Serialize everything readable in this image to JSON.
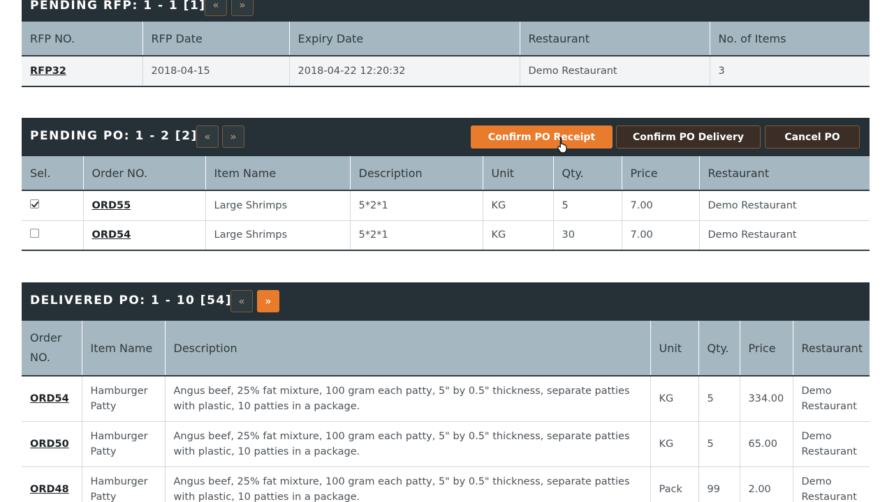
{
  "pending_rfp": {
    "title": "PENDING RFP: 1 - 1 [1]",
    "pager_prev": "«",
    "pager_next": "»",
    "columns": [
      "RFP NO.",
      "RFP Date",
      "Expiry Date",
      "Restaurant",
      "No. of Items"
    ],
    "rows": [
      [
        "RFP32",
        "2018-04-15",
        "2018-04-22 12:20:32",
        "Demo Restaurant",
        "3"
      ]
    ]
  },
  "pending_po": {
    "title": "PENDING PO: 1 - 2 [2]",
    "pager_prev": "«",
    "pager_next": "»",
    "buttons": {
      "confirm_receipt": "Confirm PO Receipt",
      "confirm_delivery": "Confirm PO Delivery",
      "cancel": "Cancel PO"
    },
    "columns": [
      "Sel.",
      "Order NO.",
      "Item Name",
      "Description",
      "Unit",
      "Qty.",
      "Price",
      "Restaurant"
    ],
    "rows": [
      {
        "checked": true,
        "order": "ORD55",
        "item": "Large Shrimps",
        "desc": "5*2*1",
        "unit": "KG",
        "qty": "5",
        "price": "7.00",
        "restaurant": "Demo Restaurant"
      },
      {
        "checked": false,
        "order": "ORD54",
        "item": "Large Shrimps",
        "desc": "5*2*1",
        "unit": "KG",
        "qty": "30",
        "price": "7.00",
        "restaurant": "Demo Restaurant"
      }
    ]
  },
  "delivered_po": {
    "title": "DELIVERED PO: 1 - 10 [54]",
    "pager_prev": "«",
    "pager_next": "»",
    "columns": [
      "Order NO.",
      "Item Name",
      "Description",
      "Unit",
      "Qty.",
      "Price",
      "Restaurant"
    ],
    "rows": [
      {
        "order": "ORD54",
        "item": "Hamburger Patty",
        "desc": "Angus beef, 25% fat mixture, 100 gram each patty, 5\" by 0.5\" thickness, separate patties with plastic, 10 patties in a package.",
        "unit": "KG",
        "qty": "5",
        "price": "334.00",
        "restaurant": "Demo Restaurant"
      },
      {
        "order": "ORD50",
        "item": "Hamburger Patty",
        "desc": "Angus beef, 25% fat mixture, 100 gram each patty, 5\" by 0.5\" thickness, separate patties with plastic, 10 patties in a package.",
        "unit": "KG",
        "qty": "5",
        "price": "65.00",
        "restaurant": "Demo Restaurant"
      },
      {
        "order": "ORD48",
        "item": "Hamburger Patty",
        "desc": "Angus beef, 25% fat mixture, 100 gram each patty, 5\" by 0.5\" thickness, separate patties with plastic, 10 patties in a package.",
        "unit": "Pack",
        "qty": "99",
        "price": "2.00",
        "restaurant": "Demo Restaurant"
      }
    ]
  },
  "colors": {
    "header_bar": "#263137",
    "accent": "#e97c2c",
    "table_header": "#a5b7c0"
  },
  "icons": {
    "cursor": "hand-pointer-icon",
    "prev": "double-chevron-left-icon",
    "next": "double-chevron-right-icon"
  }
}
